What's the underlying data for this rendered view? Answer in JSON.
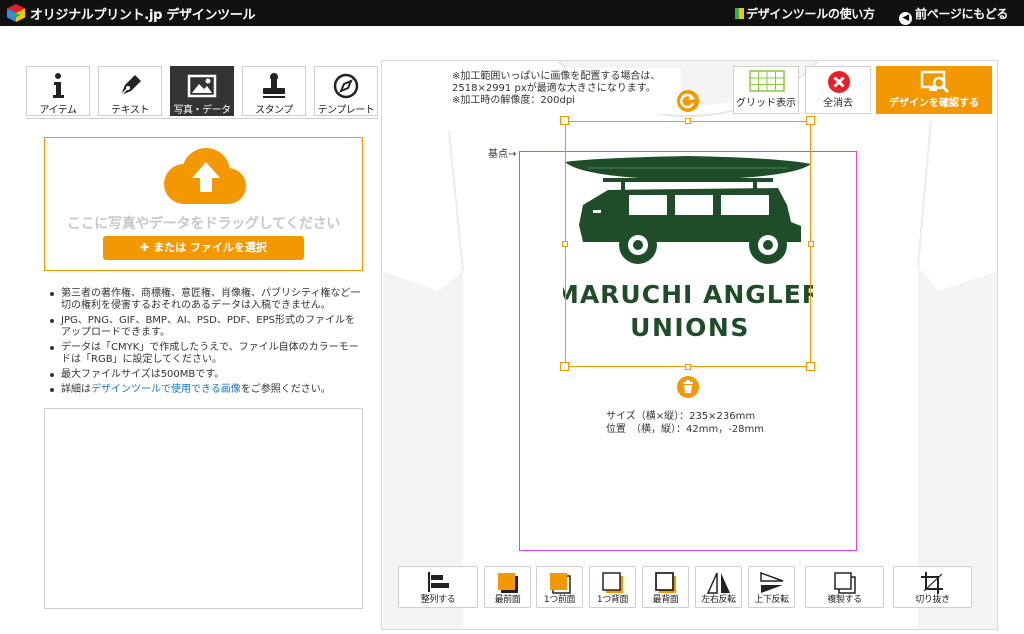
{
  "app": {
    "logo_text": "オリジナルプリント.jp",
    "tool_name": "デザインツール",
    "help_link": "デザインツールの使い方",
    "back_link": "前ページにもどる"
  },
  "tabs": [
    {
      "label": "アイテム",
      "icon": "info-icon",
      "active": false
    },
    {
      "label": "テキスト",
      "icon": "pen-icon",
      "active": false
    },
    {
      "label": "写真・データ",
      "icon": "image-icon",
      "active": true
    },
    {
      "label": "スタンプ",
      "icon": "stamp-icon",
      "active": false
    },
    {
      "label": "テンプレート",
      "icon": "compass-icon",
      "active": false
    }
  ],
  "upload": {
    "drop_text": "ここに写真やデータをドラッグしてください",
    "select_button": "または ファイルを選択",
    "notes": [
      "第三者の著作権、商標権、意匠権、肖像権、パブリシティ権など一切の権利を侵害するおそれのあるデータは入稿できません。",
      "JPG、PNG、GIF、BMP、AI、PSD、PDF、EPS形式のファイルをアップロードできます。",
      "データは「CMYK」で作成したうえで、ファイル自体のカラーモードは「RGB」に設定してください。",
      "最大ファイルサイズは500MBです。"
    ],
    "note_link_prefix": "詳細は",
    "note_link": "デザインツールで使用できる画像",
    "note_link_suffix": "をご参照ください。"
  },
  "canvas": {
    "tip_lines": [
      "※加工範囲いっぱいに画像を配置する場合は、",
      "2518×2991 pxが最適な大きさになります。",
      "※加工時の解像度：200dpi"
    ],
    "grid_button": "グリッド表示",
    "clear_button": "全消去",
    "confirm_button": "デザインを確認する",
    "origin_label": "基点→",
    "design_line1": "MARUCHI ANGLER",
    "design_line2": "UNIONS",
    "size_label": "サイズ（横×縦）：235×236mm",
    "position_label": "位置　（横，縦）：42mm，-28mm"
  },
  "toolbar": [
    {
      "label": "整列する",
      "icon": "align-icon"
    },
    {
      "label": "最前面",
      "icon": "bring-to-front-icon"
    },
    {
      "label": "1つ前面",
      "icon": "bring-forward-icon"
    },
    {
      "label": "1つ背面",
      "icon": "send-backward-icon"
    },
    {
      "label": "最背面",
      "icon": "send-to-back-icon"
    },
    {
      "label": "左右反転",
      "icon": "flip-horizontal-icon"
    },
    {
      "label": "上下反転",
      "icon": "flip-vertical-icon"
    },
    {
      "label": "複製する",
      "icon": "duplicate-icon"
    },
    {
      "label": "切り抜き",
      "icon": "crop-icon"
    }
  ],
  "colors": {
    "accent": "#f39800",
    "topbar": "#111111",
    "design_green": "#1f4d2a",
    "print_area": "#e040e8",
    "clear_red": "#e8202a"
  }
}
